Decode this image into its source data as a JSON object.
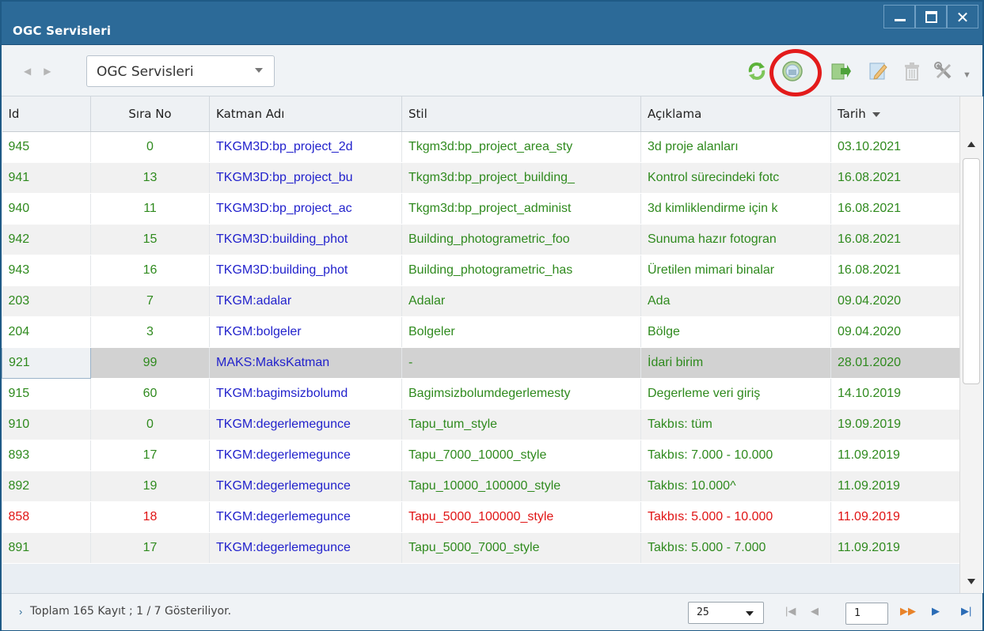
{
  "window": {
    "title": "OGC Servisleri",
    "controls": [
      "minimize-icon",
      "maximize-icon",
      "close-icon"
    ]
  },
  "toolbar": {
    "nav_back_icon": "chevron-left-icon",
    "nav_forward_icon": "chevron-right-icon",
    "combo_value": "OGC Servisleri",
    "icons": [
      "refresh-icon",
      "ogc-service-icon",
      "export-icon",
      "edit-icon",
      "trash-icon",
      "tools-icon"
    ],
    "highlight_color": "#e31b1b"
  },
  "grid": {
    "columns": [
      "Id",
      "Sıra No",
      "Katman Adı",
      "Stil",
      "Açıklama",
      "Tarih"
    ],
    "sorted_column": "Tarih",
    "sort_direction": "descending",
    "rows": [
      {
        "id": "945",
        "sira": "0",
        "katman": "TKGM3D:bp_project_2d",
        "stil": "Tkgm3d:bp_project_area_sty",
        "aciklama": "3d proje alanları",
        "tarih": "03.10.2021",
        "color": "green"
      },
      {
        "id": "941",
        "sira": "13",
        "katman": "TKGM3D:bp_project_bu",
        "stil": "Tkgm3d:bp_project_building_",
        "aciklama": "Kontrol sürecindeki fotc",
        "tarih": "16.08.2021",
        "color": "green"
      },
      {
        "id": "940",
        "sira": "11",
        "katman": "TKGM3D:bp_project_ac",
        "stil": "Tkgm3d:bp_project_administ",
        "aciklama": "3d kimliklendirme için k",
        "tarih": "16.08.2021",
        "color": "green"
      },
      {
        "id": "942",
        "sira": "15",
        "katman": "TKGM3D:building_phot",
        "stil": "Building_photogrametric_foo",
        "aciklama": "Sunuma hazır fotogran",
        "tarih": "16.08.2021",
        "color": "green"
      },
      {
        "id": "943",
        "sira": "16",
        "katman": "TKGM3D:building_phot",
        "stil": "Building_photogrametric_has",
        "aciklama": "Üretilen mimari binalar",
        "tarih": "16.08.2021",
        "color": "green"
      },
      {
        "id": "203",
        "sira": "7",
        "katman": "TKGM:adalar",
        "stil": "Adalar",
        "aciklama": "Ada",
        "tarih": "09.04.2020",
        "color": "green"
      },
      {
        "id": "204",
        "sira": "3",
        "katman": "TKGM:bolgeler",
        "stil": "Bolgeler",
        "aciklama": "Bölge",
        "tarih": "09.04.2020",
        "color": "green"
      },
      {
        "id": "921",
        "sira": "99",
        "katman": "MAKS:MaksKatman",
        "stil": "-",
        "aciklama": "İdari birim",
        "tarih": "28.01.2020",
        "color": "green",
        "selected": true
      },
      {
        "id": "915",
        "sira": "60",
        "katman": "TKGM:bagimsizbolumd",
        "stil": "Bagimsizbolumdegerlemesty",
        "aciklama": "Degerleme veri giriş",
        "tarih": "14.10.2019",
        "color": "green"
      },
      {
        "id": "910",
        "sira": "0",
        "katman": "TKGM:degerlemegunce",
        "stil": "Tapu_tum_style",
        "aciklama": "Takbıs: tüm",
        "tarih": "19.09.2019",
        "color": "green"
      },
      {
        "id": "893",
        "sira": "17",
        "katman": "TKGM:degerlemegunce",
        "stil": "Tapu_7000_10000_style",
        "aciklama": "Takbıs: 7.000 - 10.000",
        "tarih": "11.09.2019",
        "color": "green"
      },
      {
        "id": "892",
        "sira": "19",
        "katman": "TKGM:degerlemegunce",
        "stil": "Tapu_10000_100000_style",
        "aciklama": "Takbıs: 10.000^",
        "tarih": "11.09.2019",
        "color": "green"
      },
      {
        "id": "858",
        "sira": "18",
        "katman": "TKGM:degerlemegunce",
        "stil": "Tapu_5000_100000_style",
        "aciklama": "Takbıs: 5.000 - 10.000",
        "tarih": "11.09.2019",
        "color": "red"
      },
      {
        "id": "891",
        "sira": "17",
        "katman": "TKGM:degerlemegunce",
        "stil": "Tapu_5000_7000_style",
        "aciklama": "Takbıs: 5.000 - 7.000",
        "tarih": "11.09.2019",
        "color": "green"
      }
    ]
  },
  "footer": {
    "status_text": "Toplam 165 Kayıt ; 1 / 7 Gösteriliyor.",
    "page_size": "25",
    "current_page": "1",
    "icons": [
      "first-page-icon",
      "prev-page-icon",
      "next-pages-icon",
      "next-page-icon",
      "last-page-icon"
    ]
  },
  "colors": {
    "title_bar": "#2c6a98",
    "green_text": "#2f8a1e",
    "blue_text": "#2222cc",
    "red_text": "#e01515"
  }
}
